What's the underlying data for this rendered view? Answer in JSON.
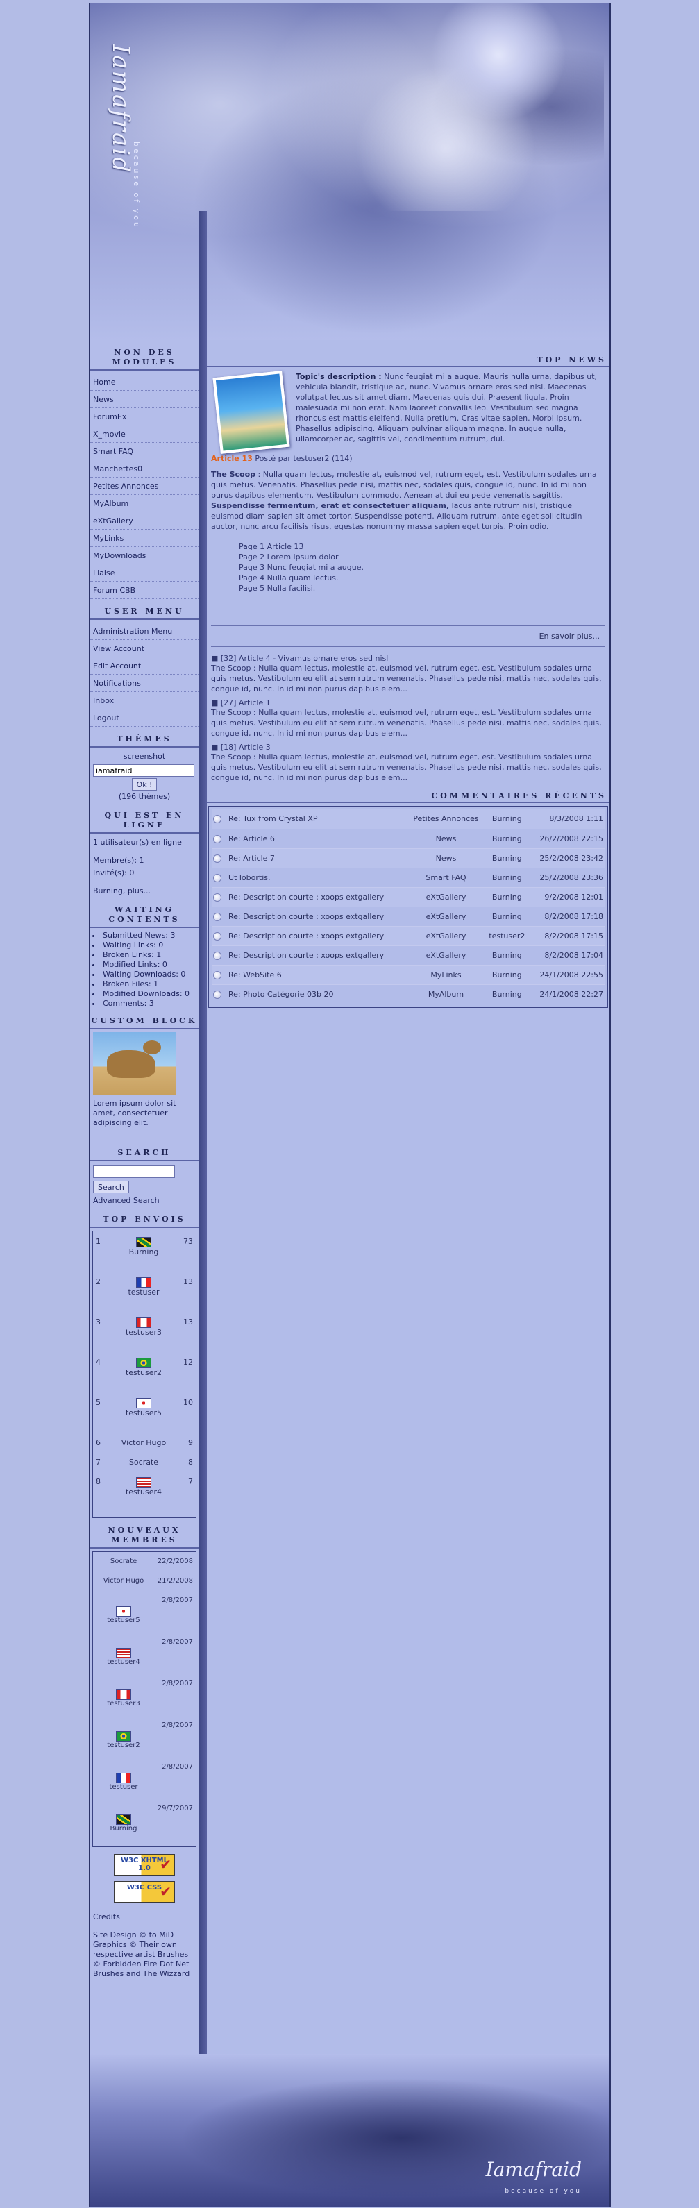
{
  "header": {
    "site_title": "Iamafraid",
    "site_slogan": "because of you"
  },
  "main_menu": {
    "title": "Non des modules",
    "items": [
      "Home",
      "News",
      "ForumEx",
      "X_movie",
      "Smart FAQ",
      "Manchettes0",
      "Petites Annonces",
      "MyAlbum",
      "eXtGallery",
      "MyLinks",
      "MyDownloads",
      "Liaise",
      "Forum CBB"
    ]
  },
  "user_menu": {
    "title": "User Menu",
    "items": [
      "Administration Menu",
      "View Account",
      "Edit Account",
      "Notifications",
      "Inbox",
      "Logout"
    ]
  },
  "themes": {
    "title": "Thèmes",
    "screenshot_label": "screenshot",
    "selected": "iamafraid",
    "ok_label": "Ok !",
    "count_text": "(196 thèmes)"
  },
  "online": {
    "title": "Qui est en ligne",
    "line1": "1 utilisateur(s) en ligne",
    "members": "Membre(s): 1",
    "guests": "Invité(s): 0",
    "names": "Burning, plus..."
  },
  "waiting": {
    "title": "Waiting Contents",
    "items": [
      "Submitted News: 3",
      "Waiting Links: 0",
      "Broken Links: 1",
      "Modified Links: 0",
      "Waiting Downloads: 0",
      "Broken Files: 1",
      "Modified Downloads: 0",
      "Comments: 3"
    ]
  },
  "custom": {
    "title": "Custom Block",
    "text": "Lorem ipsum dolor sit amet, consectetuer adipiscing elit."
  },
  "search": {
    "title": "Search",
    "button": "Search",
    "advanced": "Advanced Search"
  },
  "top_posters": {
    "title": "Top envois",
    "rows": [
      {
        "rank": "1",
        "name": "Burning",
        "count": "73",
        "flag": "jm"
      },
      {
        "rank": "2",
        "name": "testuser",
        "count": "13",
        "flag": "fr"
      },
      {
        "rank": "3",
        "name": "testuser3",
        "count": "13",
        "flag": "ca"
      },
      {
        "rank": "4",
        "name": "testuser2",
        "count": "12",
        "flag": "br"
      },
      {
        "rank": "5",
        "name": "testuser5",
        "count": "10",
        "flag": "kr"
      },
      {
        "rank": "6",
        "name": "Victor Hugo",
        "count": "9",
        "flag": ""
      },
      {
        "rank": "7",
        "name": "Socrate",
        "count": "8",
        "flag": ""
      },
      {
        "rank": "8",
        "name": "testuser4",
        "count": "7",
        "flag": "us"
      }
    ]
  },
  "new_members": {
    "title": "Nouveaux membres",
    "rows": [
      {
        "name": "Socrate",
        "date": "22/2/2008",
        "flag": ""
      },
      {
        "name": "Victor Hugo",
        "date": "21/2/2008",
        "flag": ""
      },
      {
        "name": "testuser5",
        "date": "2/8/2007",
        "flag": "kr"
      },
      {
        "name": "testuser4",
        "date": "2/8/2007",
        "flag": "us"
      },
      {
        "name": "testuser3",
        "date": "2/8/2007",
        "flag": "ca"
      },
      {
        "name": "testuser2",
        "date": "2/8/2007",
        "flag": "br"
      },
      {
        "name": "testuser",
        "date": "2/8/2007",
        "flag": "fr"
      },
      {
        "name": "Burning",
        "date": "29/7/2007",
        "flag": "jm"
      }
    ]
  },
  "badges": {
    "xhtml": "W3C XHTML 1.0",
    "css": "W3C CSS"
  },
  "credits": {
    "title": "Credits",
    "text": "Site Design © to MiD Graphics © Their own respective artist Brushes © Forbidden Fire Dot Net Brushes and The Wizzard"
  },
  "top_news": {
    "title": "Top News",
    "desc_label": "Topic's description :",
    "desc_text": "Nunc feugiat mi a augue. Mauris nulla urna, dapibus ut, vehicula blandit, tristique ac, nunc. Vivamus ornare eros sed nisl. Maecenas volutpat lectus sit amet diam. Maecenas quis dui. Praesent ligula. Proin malesuada mi non erat. Nam laoreet convallis leo. Vestibulum sed magna rhoncus est mattis eleifend. Nulla pretium. Cras vitae sapien. Morbi ipsum. Phasellus adipiscing. Aliquam pulvinar aliquam magna. In augue nulla, ullamcorper ac, sagittis vel, condimentum rutrum, dui.",
    "article_link": "Article 13",
    "posted_by": "Posté par testuser2 (114)",
    "scoop_label": "The Scoop",
    "scoop_text": " : Nulla quam lectus, molestie at, euismod vel, rutrum eget, est. Vestibulum sodales urna quis metus. Venenatis. Phasellus pede nisi, mattis nec, sodales quis, congue id, nunc. In id mi non purus dapibus elementum. Vestibulum commodo. Aenean at dui eu pede venenatis sagittis. ",
    "scoop_bold": "Suspendisse fermentum, erat et consectetuer aliquam,",
    "scoop_rest": " lacus ante rutrum nisl, tristique euismod diam sapien sit amet tortor. Suspendisse potenti. Aliquam rutrum, ante eget sollicitudin auctor, nunc arcu facilisis risus, egestas nonummy massa sapien eget turpis. Proin odio.",
    "pages": [
      "Page 1 Article 13",
      "Page 2 Lorem ipsum dolor",
      "Page 3 Nunc feugiat mi a augue.",
      "Page 4 Nulla quam lectus.",
      "Page 5 Nulla facilisi."
    ],
    "read_more": "En savoir plus...",
    "others": [
      {
        "title": "[32] Article 4 - Vivamus ornare eros sed nisl",
        "text": "The Scoop : Nulla quam lectus, molestie at, euismod vel, rutrum eget, est. Vestibulum sodales urna quis metus. Vestibulum eu elit at sem rutrum venenatis. Phasellus pede nisi, mattis nec, sodales quis, congue id, nunc. In id mi non purus dapibus elem..."
      },
      {
        "title": "[27] Article 1",
        "text": "The Scoop : Nulla quam lectus, molestie at, euismod vel, rutrum eget, est. Vestibulum sodales urna quis metus. Vestibulum eu elit at sem rutrum venenatis. Phasellus pede nisi, mattis nec, sodales quis, congue id, nunc. In id mi non purus dapibus elem..."
      },
      {
        "title": "[18] Article 3",
        "text": "The Scoop : Nulla quam lectus, molestie at, euismod vel, rutrum eget, est. Vestibulum sodales urna quis metus. Vestibulum eu elit at sem rutrum venenatis. Phasellus pede nisi, mattis nec, sodales quis, congue id, nunc. In id mi non purus dapibus elem..."
      }
    ]
  },
  "recent_comments": {
    "title": "Commentaires récents",
    "rows": [
      {
        "title": "Re: Tux from Crystal XP",
        "module": "Petites Annonces",
        "user": "Burning",
        "date": "8/3/2008 1:11"
      },
      {
        "title": "Re: Article 6",
        "module": "News",
        "user": "Burning",
        "date": "26/2/2008 22:15"
      },
      {
        "title": "Re: Article 7",
        "module": "News",
        "user": "Burning",
        "date": "25/2/2008 23:42"
      },
      {
        "title": "Ut lobortis.",
        "module": "Smart FAQ",
        "user": "Burning",
        "date": "25/2/2008 23:36"
      },
      {
        "title": "Re: Description courte : xoops extgallery",
        "module": "eXtGallery",
        "user": "Burning",
        "date": "9/2/2008 12:01"
      },
      {
        "title": "Re: Description courte : xoops extgallery",
        "module": "eXtGallery",
        "user": "Burning",
        "date": "8/2/2008 17:18"
      },
      {
        "title": "Re: Description courte : xoops extgallery",
        "module": "eXtGallery",
        "user": "testuser2",
        "date": "8/2/2008 17:15"
      },
      {
        "title": "Re: Description courte : xoops extgallery",
        "module": "eXtGallery",
        "user": "Burning",
        "date": "8/2/2008 17:04"
      },
      {
        "title": "Re: WebSite 6",
        "module": "MyLinks",
        "user": "Burning",
        "date": "24/1/2008 22:55"
      },
      {
        "title": "Re: Photo Catégorie 03b 20",
        "module": "MyAlbum",
        "user": "Burning",
        "date": "24/1/2008 22:27"
      }
    ]
  },
  "footer": {
    "signature": "Iamafraid",
    "slogan": "because of you"
  }
}
